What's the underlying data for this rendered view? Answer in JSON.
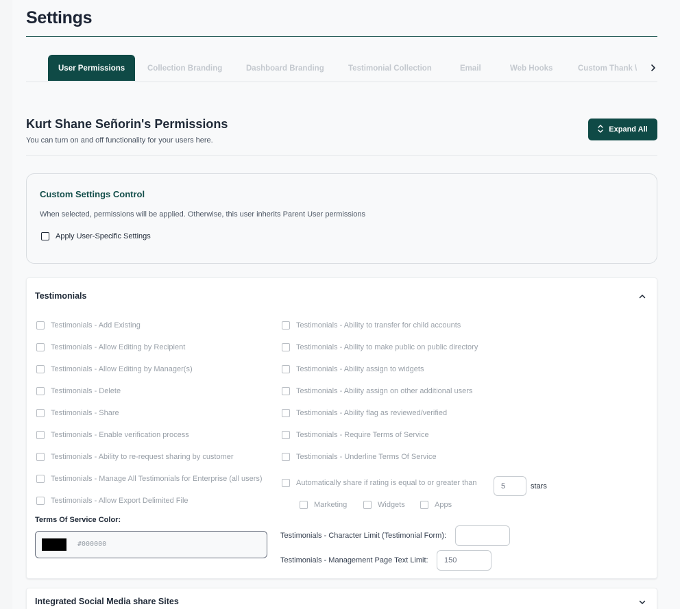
{
  "page": {
    "title": "Settings"
  },
  "tabs": [
    {
      "label": "User Permissions",
      "active": true
    },
    {
      "label": "Collection Branding"
    },
    {
      "label": "Dashboard Branding"
    },
    {
      "label": "Testimonial Collection"
    },
    {
      "label": "Email"
    },
    {
      "label": "Web Hooks"
    },
    {
      "label": "Custom Thank \\"
    }
  ],
  "permissions_header": {
    "title": "Kurt Shane Señorin's Permissions",
    "subtitle": "You can turn on and off functionality for your users here.",
    "expand_all_label": "Expand All"
  },
  "custom_settings": {
    "title": "Custom Settings Control",
    "description": "When selected, permissions will be applied. Otherwise, this user inherits Parent User permissions",
    "apply_label": "Apply User-Specific Settings",
    "apply_checked": false
  },
  "testimonials": {
    "title": "Testimonials",
    "left": [
      "Testimonials - Add Existing",
      "Testimonials - Allow Editing by Recipient",
      "Testimonials - Allow Editing by Manager(s)",
      "Testimonials - Delete",
      "Testimonials - Share",
      "Testimonials - Enable verification process",
      "Testimonials - Ability to re-request sharing by customer",
      "Testimonials - Manage All Testimonials for Enterprise (all users)",
      "Testimonials - Allow Export Delimited File"
    ],
    "right": [
      "Testimonials - Ability to transfer for child accounts",
      "Testimonials - Ability to make public on public directory",
      "Testimonials - Ability assign to widgets",
      "Testimonials - Ability assign on other additional users",
      "Testimonials - Ability flag as reviewed/verified",
      "Testimonials - Require Terms of Service",
      "Testimonials - Underline Terms Of Service"
    ],
    "auto_share_label": "Automatically share if rating is equal to or greater than",
    "auto_share_stars": "5",
    "stars_label": "stars",
    "share_targets": [
      "Marketing",
      "Widgets",
      "Apps"
    ],
    "tos_color_label": "Terms Of Service Color:",
    "tos_color_value": "#000000",
    "tos_color_swatch": "#000000",
    "char_limit_label": "Testimonials - Character Limit (Testimonial Form):",
    "char_limit_value": "",
    "mgmt_limit_label": "Testimonials - Management Page Text Limit:",
    "mgmt_limit_value": "150"
  },
  "social": {
    "title": "Integrated Social Media share Sites"
  },
  "colors": {
    "brand": "#0f4a46",
    "disabled_text": "#9aa1a9"
  },
  "icons": {
    "tab_next": "chevron-right-icon",
    "expand": "expand-vertical-icon",
    "collapse": "chevron-up-icon",
    "expand_section": "chevron-down-icon"
  }
}
